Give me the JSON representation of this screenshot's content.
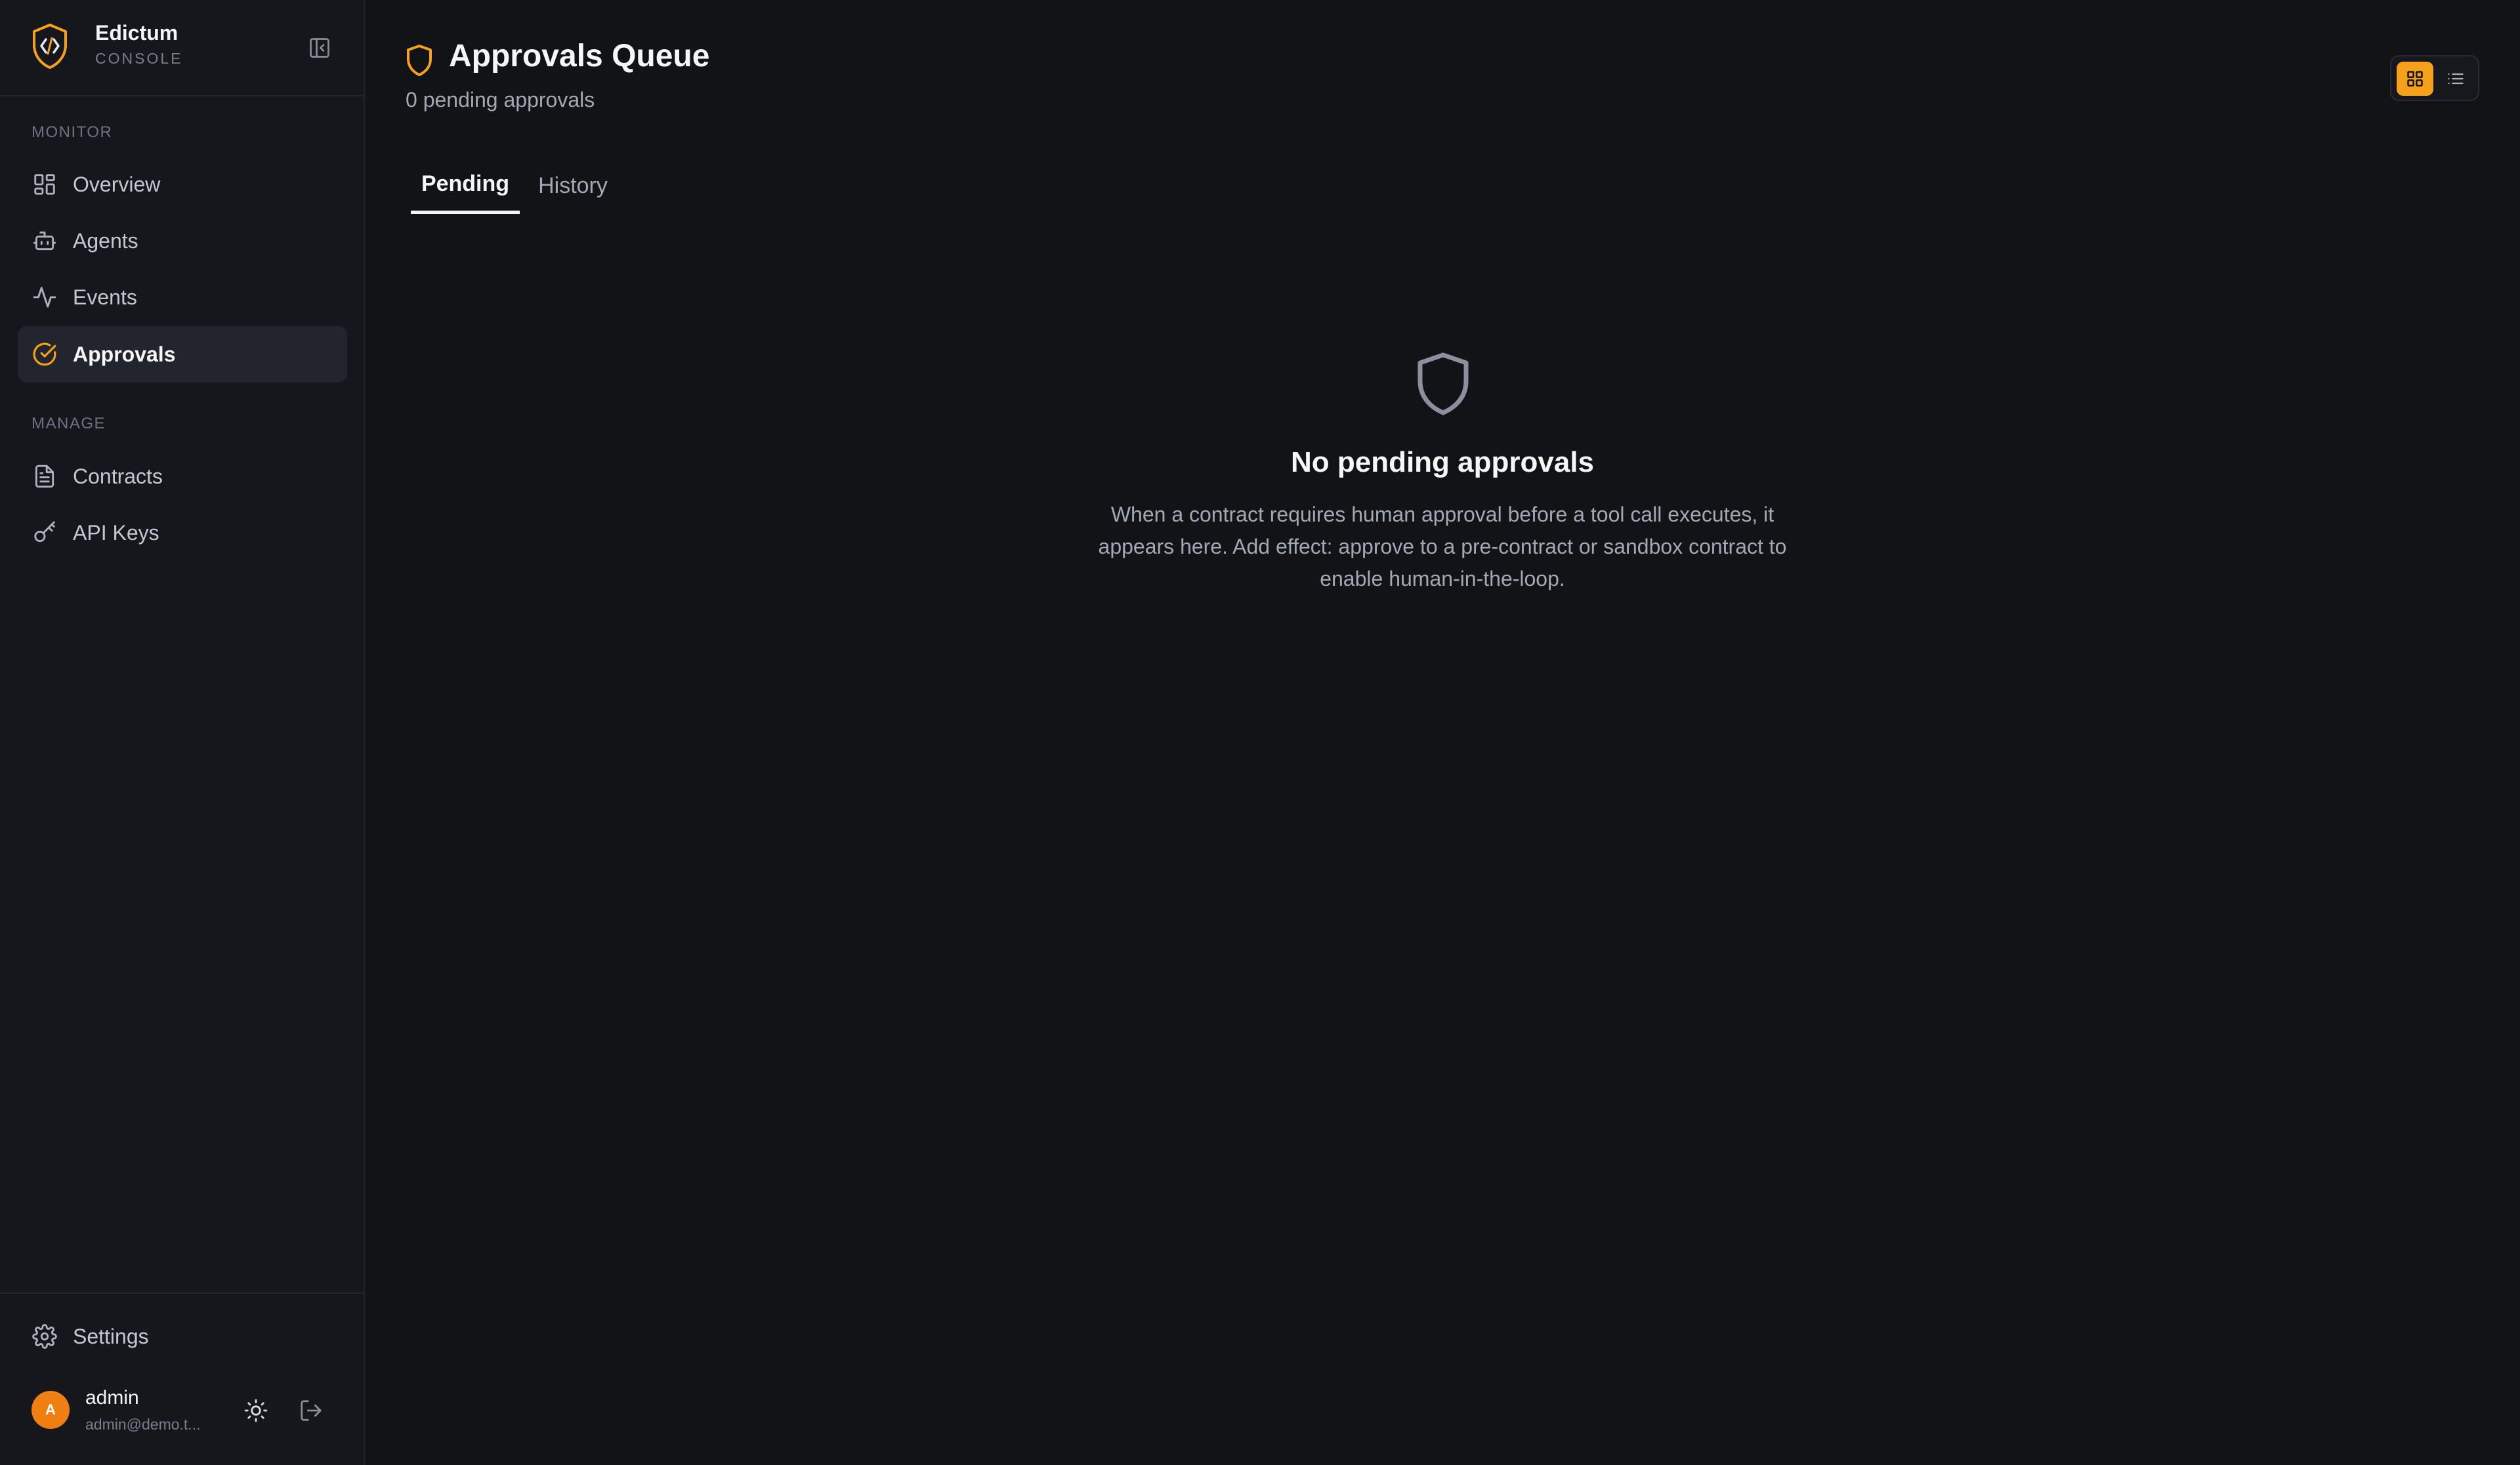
{
  "brand": {
    "name": "Edictum",
    "subtitle": "CONSOLE",
    "accent": "#f6a11a"
  },
  "sidebar": {
    "sections": [
      {
        "label": "MONITOR",
        "items": [
          {
            "label": "Overview",
            "icon": "grid-icon",
            "active": false
          },
          {
            "label": "Agents",
            "icon": "bot-icon",
            "active": false
          },
          {
            "label": "Events",
            "icon": "activity-icon",
            "active": false
          },
          {
            "label": "Approvals",
            "icon": "check-circle-icon",
            "active": true
          }
        ]
      },
      {
        "label": "MANAGE",
        "items": [
          {
            "label": "Contracts",
            "icon": "file-text-icon",
            "active": false
          },
          {
            "label": "API Keys",
            "icon": "key-icon",
            "active": false
          }
        ]
      }
    ],
    "settings_label": "Settings"
  },
  "user": {
    "initial": "A",
    "name": "admin",
    "email": "admin@demo.t..."
  },
  "page": {
    "title": "Approvals Queue",
    "subtitle": "0 pending approvals",
    "tabs": [
      {
        "label": "Pending",
        "active": true
      },
      {
        "label": "History",
        "active": false
      }
    ],
    "view_mode": "grid"
  },
  "empty_state": {
    "title": "No pending approvals",
    "description": "When a contract requires human approval before a tool call executes, it appears here. Add effect: approve to a pre-contract or sandbox contract to enable human-in-the-loop."
  }
}
